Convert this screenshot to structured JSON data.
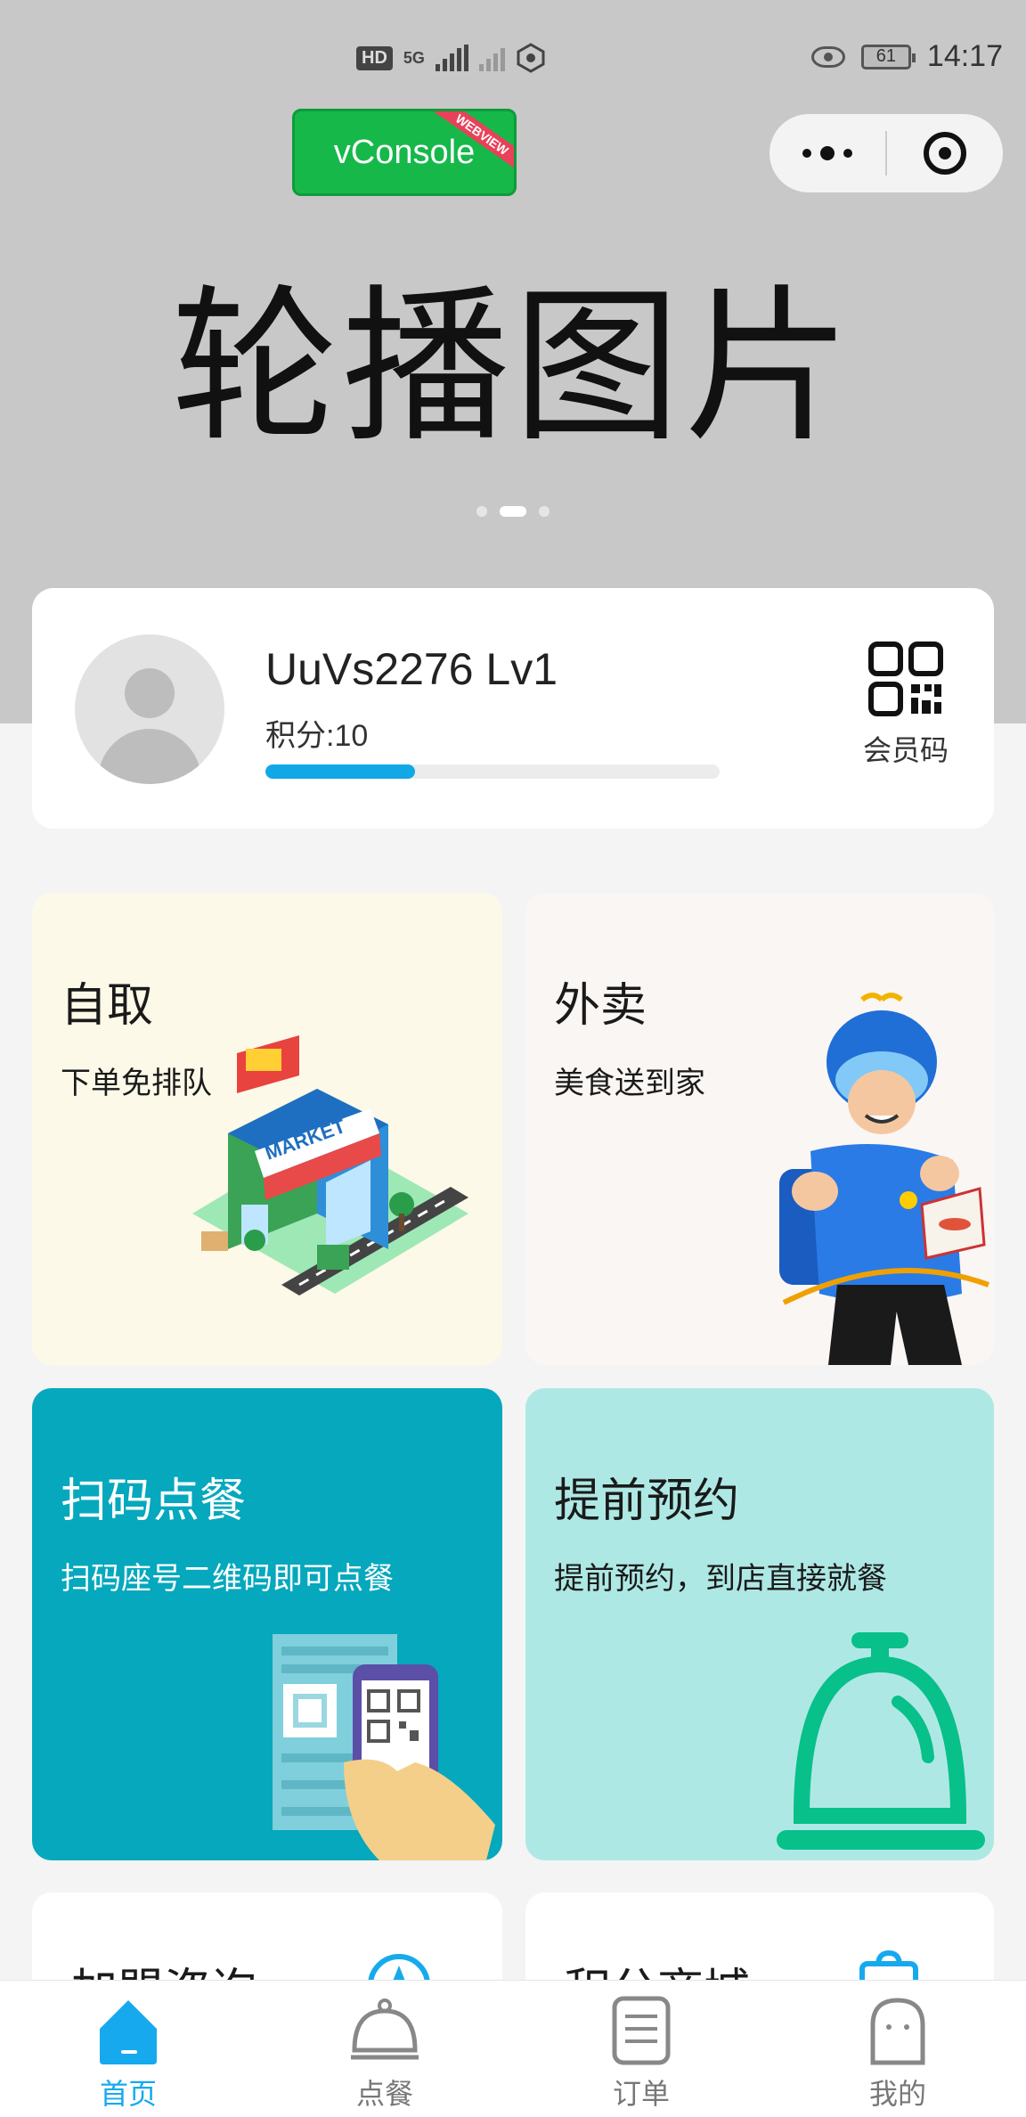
{
  "status_bar": {
    "network_left": "HD",
    "network_5g": "5G",
    "battery": "61",
    "time": "14:17"
  },
  "vconsole": {
    "label": "vConsole",
    "badge": "WEBVIEW"
  },
  "banner": {
    "text": "轮播图片",
    "dots": 3,
    "active_dot": 1
  },
  "member": {
    "name": "UuVs2276 Lv1",
    "points": "积分:10",
    "progress": 0.33,
    "code_label": "会员码"
  },
  "tiles": {
    "pickup": {
      "title": "自取",
      "subtitle": "下单免排队"
    },
    "delivery": {
      "title": "外卖",
      "subtitle": "美食送到家"
    },
    "scan": {
      "title": "扫码点餐",
      "subtitle": "扫码座号二维码即可点餐"
    },
    "reserve": {
      "title": "提前预约",
      "subtitle": "提前预约，到店直接就餐"
    },
    "join": {
      "title": "加盟咨询"
    },
    "mall": {
      "title": "积分商城"
    }
  },
  "tabbar": {
    "items": [
      {
        "label": "首页",
        "icon": "home-icon",
        "active": true
      },
      {
        "label": "点餐",
        "icon": "cloche-icon",
        "active": false
      },
      {
        "label": "订单",
        "icon": "order-list-icon",
        "active": false
      },
      {
        "label": "我的",
        "icon": "ghost-profile-icon",
        "active": false
      }
    ],
    "active_color": "#17a9ee",
    "inactive_color": "#777777"
  },
  "colors": {
    "banner_bg": "#c8c8c8",
    "progress": "#12a8e6",
    "scan_tile": "#05a8bd",
    "reserve_tile": "#aee8e4",
    "vconsole": "#16b84a"
  }
}
